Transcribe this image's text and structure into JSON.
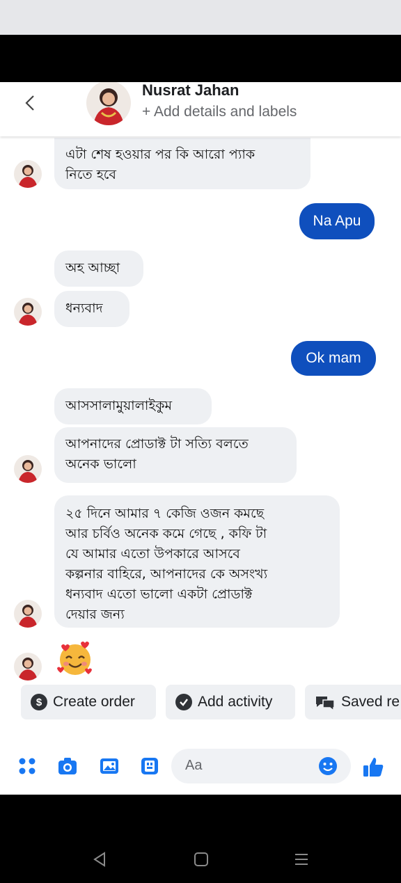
{
  "header": {
    "name": "Nusrat Jahan",
    "subtitle": "+ Add details and labels"
  },
  "messages": {
    "in1": [
      "এটা শেষ হওয়ার পর কি আরো প্যাক",
      "নিতে হবে"
    ],
    "out1": "Na Apu",
    "in2": "অহ আচ্ছা",
    "in3": "ধন্যবাদ",
    "out2": "Ok mam",
    "in4": "আসসালামুয়ালাইকুম",
    "in5": [
      "আপনাদের প্রোডাক্ট টা সত্যি বলতে",
      "অনেক ভালো"
    ],
    "in6": [
      "২৫ দিনে আমার ৭ কেজি ওজন কমছে",
      "আর চর্বিও অনেক কমে গেছে , কফি টা",
      "যে আমার এতো উপকারে আসবে",
      "কল্পনার বাহিরে, আপনাদের কে অসংখ্য",
      "ধন্যবাদ এতো ভালো একটা প্রোডাক্ট",
      "দেয়ার জন্য"
    ],
    "reaction_emoji": "smiling-face-with-hearts"
  },
  "quick_actions": {
    "create_order": "Create order",
    "create_order_icon": "$",
    "add_activity": "Add activity",
    "saved_replies": "Saved re"
  },
  "composer": {
    "placeholder": "Aa"
  },
  "colors": {
    "outgoing_bubble": "#0f4fbd",
    "incoming_bubble": "#eef0f3",
    "accent": "#1877f2"
  }
}
